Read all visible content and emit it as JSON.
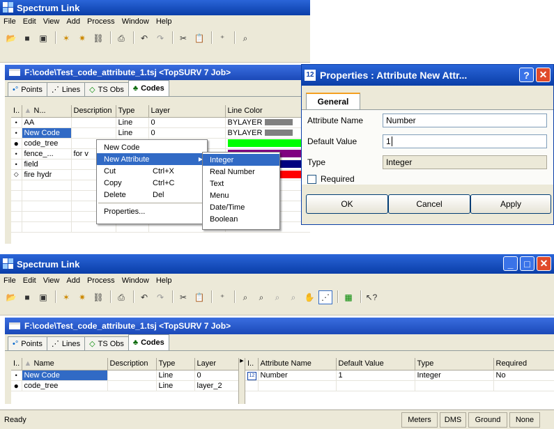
{
  "app_title": "Spectrum Link",
  "menu": [
    "File",
    "Edit",
    "View",
    "Add",
    "Process",
    "Window",
    "Help"
  ],
  "doc_title": "F:\\code\\Test_code_attribute_1.tsj  <TopSURV 7 Job>",
  "tabs": [
    "Points",
    "Lines",
    "TS Obs",
    "Codes"
  ],
  "top_table": {
    "headers": [
      "I..",
      "N...",
      "Description",
      "Type",
      "Layer",
      "Line Color"
    ],
    "rows": [
      {
        "name": "AA",
        "desc": "",
        "type": "Line",
        "layer": "0",
        "color": "BYLAYER",
        "swatch": "#808080"
      },
      {
        "name": "New Code",
        "desc": "",
        "type": "Line",
        "layer": "0",
        "color": "BYLAYER",
        "swatch": "#808080"
      },
      {
        "name": "code_tree",
        "desc": "",
        "type": "",
        "layer": "",
        "color": "",
        "swatch": "#00ff00"
      },
      {
        "name": "fence_...",
        "desc": "for v",
        "type": "",
        "layer": "",
        "color": "",
        "swatch": "#800080"
      },
      {
        "name": "field",
        "desc": "",
        "type": "",
        "layer": "",
        "color": "",
        "swatch": "#000080"
      },
      {
        "name": "fire hydr",
        "desc": "",
        "type": "",
        "layer": "",
        "color": "",
        "swatch": "#ff0000"
      }
    ]
  },
  "context_menu": {
    "items": [
      "New Code",
      "New Attribute",
      "Cut",
      "Copy",
      "Delete",
      "Properties..."
    ],
    "shortcuts": {
      "cut": "Ctrl+X",
      "copy": "Ctrl+C",
      "delete": "Del"
    }
  },
  "submenu": [
    "Integer",
    "Real Number",
    "Text",
    "Menu",
    "Date/Time",
    "Boolean"
  ],
  "dialog": {
    "title": "Properties : Attribute New Attr...",
    "tab": "General",
    "name_label": "Attribute Name",
    "name_value": "Number",
    "default_label": "Default Value",
    "default_value": "1",
    "type_label": "Type",
    "type_value": "Integer",
    "required_label": "Required",
    "ok": "OK",
    "cancel": "Cancel",
    "apply": "Apply"
  },
  "bottom_table": {
    "headers": [
      "I..",
      "Name",
      "Description",
      "Type",
      "Layer"
    ],
    "rows": [
      {
        "name": "New Code",
        "type": "Line",
        "layer": "0"
      },
      {
        "name": "code_tree",
        "type": "Line",
        "layer": "layer_2"
      }
    ]
  },
  "attr_table": {
    "headers": [
      "I..",
      "Attribute Name",
      "Default Value",
      "Type",
      "Required"
    ],
    "rows": [
      {
        "name": "Number",
        "default": "1",
        "type": "Integer",
        "required": "No"
      }
    ]
  },
  "status": {
    "text": "Ready",
    "cells": [
      "Meters",
      "DMS",
      "Ground",
      "None"
    ]
  },
  "colors": {
    "titlebar": "#0a3ea8",
    "selection": "#316ac5",
    "close": "#e04a2a"
  }
}
